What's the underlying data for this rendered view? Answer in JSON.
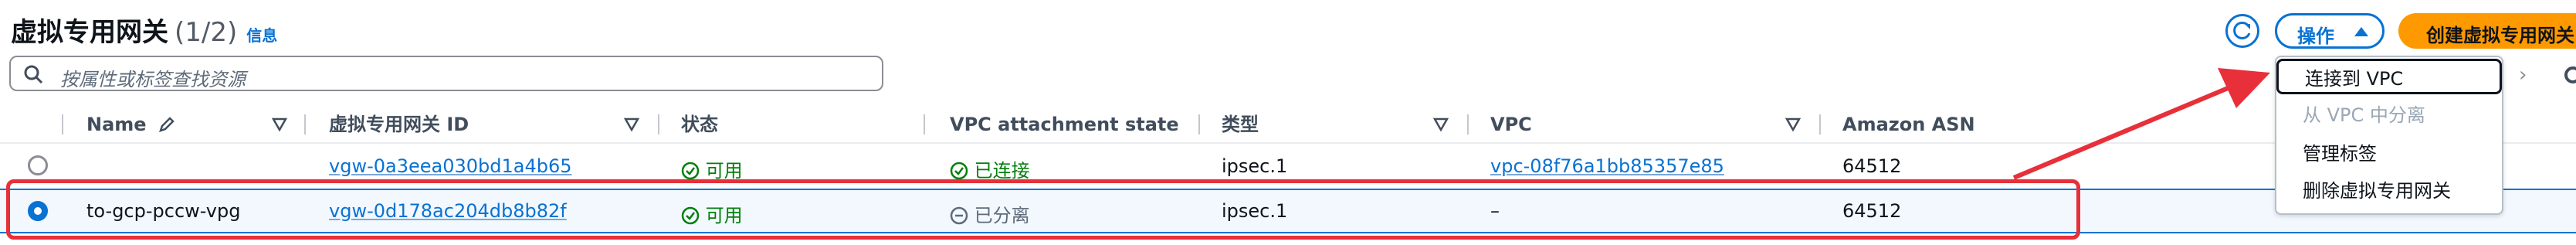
{
  "header": {
    "title": "虚拟专用网关",
    "count": "(1/2)",
    "info_link": "信息",
    "actions_label": "操作",
    "create_label": "创建虚拟专用网关"
  },
  "search": {
    "placeholder": "按属性或标签查找资源"
  },
  "table": {
    "columns": [
      "Name",
      "虚拟专用网关 ID",
      "状态",
      "VPC attachment state",
      "类型",
      "VPC",
      "Amazon ASN"
    ],
    "rows": [
      {
        "selected": false,
        "name": "",
        "id": "vgw-0a3eea030bd1a4b65",
        "status": "可用",
        "attachment": "已连接",
        "type": "ipsec.1",
        "vpc": "vpc-08f76a1bb85357e85",
        "asn": "64512"
      },
      {
        "selected": true,
        "name": "to-gcp-pccw-vpg",
        "id": "vgw-0d178ac204db8b82f",
        "status": "可用",
        "attachment": "已分离",
        "type": "ipsec.1",
        "vpc": "–",
        "asn": "64512"
      }
    ]
  },
  "actions_menu": {
    "items": [
      {
        "label": "连接到 VPC",
        "state": "highlighted"
      },
      {
        "label": "从 VPC 中分离",
        "state": "disabled"
      },
      {
        "label": "管理标签",
        "state": "enabled"
      },
      {
        "label": "删除虚拟专用网关",
        "state": "enabled"
      }
    ]
  },
  "colors": {
    "accent": "#0972d3",
    "primary_button": "#ff9900",
    "success": "#037f0c",
    "annotation_red": "#e7303a"
  }
}
